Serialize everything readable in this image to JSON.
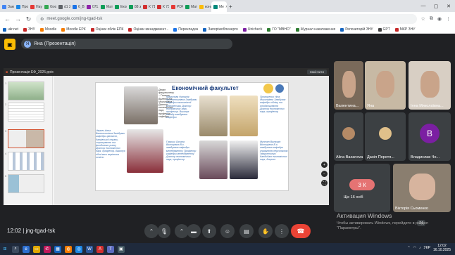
{
  "browser": {
    "tabs": [
      {
        "label": "Зако",
        "color": "#4285f4"
      },
      {
        "label": "Профе",
        "color": "#1e88e5"
      },
      {
        "label": "Наук",
        "color": "#e53935"
      },
      {
        "label": "Googl",
        "color": "#34a853"
      },
      {
        "label": "d1 20",
        "color": "#5f6368"
      },
      {
        "label": "6_Вн",
        "color": "#1a73e8"
      },
      {
        "label": "071.e",
        "color": "#8e24aa"
      },
      {
        "label": "Матр",
        "color": "#0f9d58"
      },
      {
        "label": "Еконо",
        "color": "#0f9d58"
      },
      {
        "label": "88 з",
        "color": "#0f9d58"
      },
      {
        "label": "К 71",
        "color": "#d32f2f"
      },
      {
        "label": "К 73-",
        "color": "#d32f2f"
      },
      {
        "label": "PDF к",
        "color": "#e53935"
      },
      {
        "label": "Матр",
        "color": "#0f9d58"
      },
      {
        "label": "конф",
        "color": "#fbbc04"
      },
      {
        "label": "Me",
        "color": "#00897b",
        "active": true
      }
    ],
    "url": "meet.google.com/jng-tgad-tsk",
    "bookmarks": [
      {
        "label": "ukr.net",
        "color": "#1565c0"
      },
      {
        "label": "ЗНУ",
        "color": "#c62828"
      },
      {
        "label": "Moodle",
        "color": "#f57c00"
      },
      {
        "label": "Moodle ЕРК",
        "color": "#f57c00"
      },
      {
        "label": "Оцінки облік ЕПК",
        "color": "#c62828"
      },
      {
        "label": "Оцінки менеджмент...",
        "color": "#c62828"
      },
      {
        "label": "Перекладач",
        "color": "#1a73e8"
      },
      {
        "label": "Запоріжобленерго",
        "color": "#1565c0"
      },
      {
        "label": "Unicheck",
        "color": "#7b1fa2"
      },
      {
        "label": "ГО \"МВНО\"",
        "color": "#2e7d32"
      },
      {
        "label": "Журнал накатаження",
        "color": "#2e7d32"
      },
      {
        "label": "Репозитарій ЗНУ",
        "color": "#1565c0"
      },
      {
        "label": "GPT",
        "color": "#444444"
      },
      {
        "label": "МКР ЗНУ",
        "color": "#c62828"
      }
    ]
  },
  "meet": {
    "presenter_label": "Яна (Презентація)",
    "presenter_initial": "Я",
    "presentation_filename": "Презентація ЕФ_2025.pptx",
    "close_label": "Закінчити",
    "slide": {
      "title": "Економічний факультет",
      "people": [
        {
          "text": "Декан факультету – Гальчак Валентина Миколаївна Доктор економічних наук, професор кафедри"
        },
        {
          "text": "Мамонова Наталія Костянтинівна Завідувач кафедри економічної кібернетики Доктор економічних наук, професор. Виконує посаду завідувача кафедри"
        },
        {
          "text": "Прохоренко Ніна Миколаївна Завідувач кафедри обліку та оподаткування Доктор економічних наук, професор"
        },
        {
          "text": "Черкез Анна Валентинівна Завідувач кафедри фінансів, банківської справи, страхування та фондового ринку Доктор економічних наук, професор. Виконує обов'язки керівника освіти"
        },
        {
          "text": "Гавриш Оксана Вікторівна В.о. завідувача кафедри менеджменту Професор кафедри менеджменту Доктор економічних наук, професор"
        },
        {
          "text": "Мунтян Вікторія Вікторівна В.о. завідувача кафедри управління персоналом і маркетингу Кандидат економічних наук, доцент"
        }
      ]
    },
    "participants": [
      {
        "name": "Валентина...",
        "initial": "",
        "bg": "#7a6a5a"
      },
      {
        "name": "Яна",
        "initial": "",
        "bg": "#c7b9a4"
      },
      {
        "name": "Інна Миколаївна...",
        "initial": "",
        "bg": "#d8cfc4"
      },
      {
        "name": "Alina Bazanova",
        "initial": "",
        "bg": "#3c4043"
      },
      {
        "name": "Даніл Перетя...",
        "initial": "",
        "bg": "#3c4043"
      },
      {
        "name": "Владислав Чо...",
        "initial": "В",
        "bg": "#3c4043"
      },
      {
        "name": "Ще 16 осіб",
        "initial": "З К",
        "bg": "#3c4043"
      },
      {
        "name": "Вікторія Сьоменко",
        "initial": "",
        "bg": "#8a7e6f"
      }
    ],
    "meeting_code": "jng-tgad-tsk",
    "time": "12:02",
    "counter": "24"
  },
  "watermark": {
    "title": "Активация Windows",
    "subtitle": "Чтобы активировать Windows, перейдите в раздел \"Параметры\"."
  },
  "taskbar": {
    "lang": "УКР",
    "clock_time": "12:02",
    "clock_date": "16.10.2025"
  }
}
